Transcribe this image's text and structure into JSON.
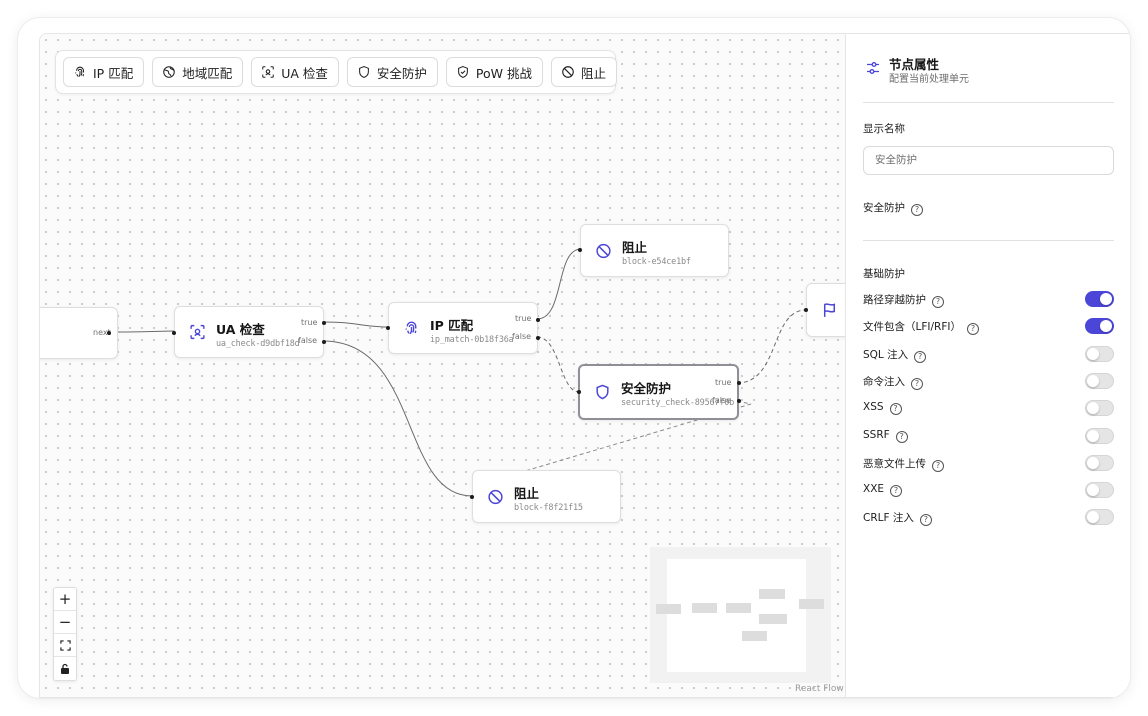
{
  "toolbar": {
    "items": [
      {
        "label": "IP 匹配",
        "icon": "fingerprint-icon"
      },
      {
        "label": "地域匹配",
        "icon": "globe-icon"
      },
      {
        "label": "UA 检查",
        "icon": "scan-face-icon"
      },
      {
        "label": "安全防护",
        "icon": "shield-icon"
      },
      {
        "label": "PoW 挑战",
        "icon": "shield-check-icon"
      },
      {
        "label": "阻止",
        "icon": "ban-icon"
      }
    ]
  },
  "flow": {
    "nodes": {
      "partial": {
        "handle_label": "next"
      },
      "ua_check": {
        "title": "UA 检查",
        "id": "ua_check-d9dbf18d",
        "true_label": "true",
        "false_label": "false"
      },
      "ip_match": {
        "title": "IP 匹配",
        "id": "ip_match-0b18f36a",
        "true_label": "true",
        "false_label": "false"
      },
      "block1": {
        "title": "阻止",
        "id": "block-e54ce1bf"
      },
      "security": {
        "title": "安全防护",
        "id": "security_check-89567f0b",
        "true_label": "true",
        "false_label": "false"
      },
      "block2": {
        "title": "阻止",
        "id": "block-f8f21f15"
      },
      "flag": {
        "icon": "flag-icon"
      }
    },
    "accent_color": "#4b46d8",
    "attribution": "React Flow"
  },
  "zoom_controls": {
    "zoom_in": "+",
    "zoom_out": "−"
  },
  "panel": {
    "title": "节点属性",
    "subtitle": "配置当前处理单元",
    "display_name_label": "显示名称",
    "display_name_value": "安全防护",
    "type_label": "安全防护",
    "section_label": "基础防护",
    "toggles": [
      {
        "label": "路径穿越防护",
        "on": true
      },
      {
        "label": "文件包含（LFI/RFI）",
        "on": true
      },
      {
        "label": "SQL 注入",
        "on": false
      },
      {
        "label": "命令注入",
        "on": false
      },
      {
        "label": "XSS",
        "on": false
      },
      {
        "label": "SSRF",
        "on": false
      },
      {
        "label": "恶意文件上传",
        "on": false
      },
      {
        "label": "XXE",
        "on": false
      },
      {
        "label": "CRLF 注入",
        "on": false
      }
    ]
  }
}
